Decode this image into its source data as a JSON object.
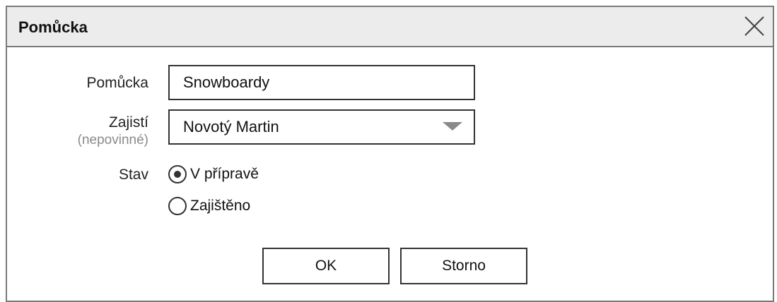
{
  "dialog": {
    "title": "Pomůcka"
  },
  "form": {
    "item": {
      "label": "Pomůcka",
      "value": "Snowboardy"
    },
    "assignee": {
      "label": "Zajistí",
      "sublabel": "(nepovinné)",
      "selected": "Novotý Martin"
    },
    "status": {
      "label": "Stav",
      "options": [
        "V přípravě",
        "Zajištěno"
      ],
      "selected_index": 0
    }
  },
  "buttons": {
    "ok_label": "OK",
    "cancel_label": "Storno"
  },
  "icons": {
    "close": "close-icon",
    "dropdown": "chevron-down-icon"
  }
}
